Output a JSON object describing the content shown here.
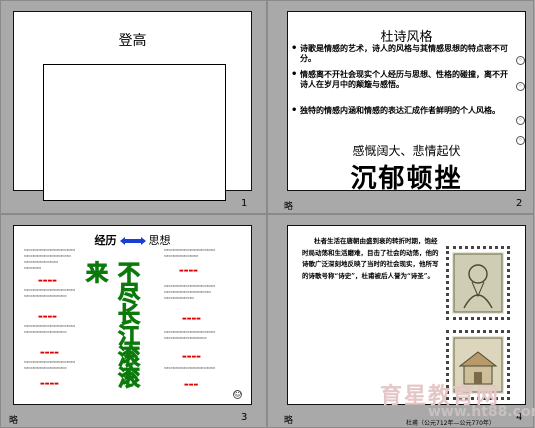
{
  "slides": [
    {
      "number": "1",
      "title": "登高"
    },
    {
      "number": "2",
      "tag": "略",
      "title": "杜诗风格",
      "bullets": [
        "诗歌是情感的艺术，诗人的风格与其情感思想的特点密不可分。",
        "情感离不开社会现实个人经历与思想、性格的碰撞，离不开诗人在岁月中的颠簸与感悟。",
        "独特的情感内涵和情感的表达汇成作者鲜明的个人风格。"
      ],
      "subtitle": "感慨阔大、悲情起伏",
      "big_text": "沉郁顿挫"
    },
    {
      "number": "3",
      "tag": "略",
      "head_left": "经历",
      "head_right": "思想",
      "vertical_text": "不尽长江滚滚来"
    },
    {
      "number": "4",
      "tag": "略",
      "body": "杜者生活在唐朝由盛到衰的转折时期，饱经时局动荡和生活磨难，目击了社会的动荡，他的诗歌广泛深刻地反映了当时的社会现实，他所写的诗歌号称“诗史”，杜甫被后人誉为“诗圣”。",
      "caption": "杜甫（公元712年—公元770年）"
    }
  ],
  "watermark": {
    "line1": "育星教育网",
    "line2": "www.ht88.com"
  }
}
